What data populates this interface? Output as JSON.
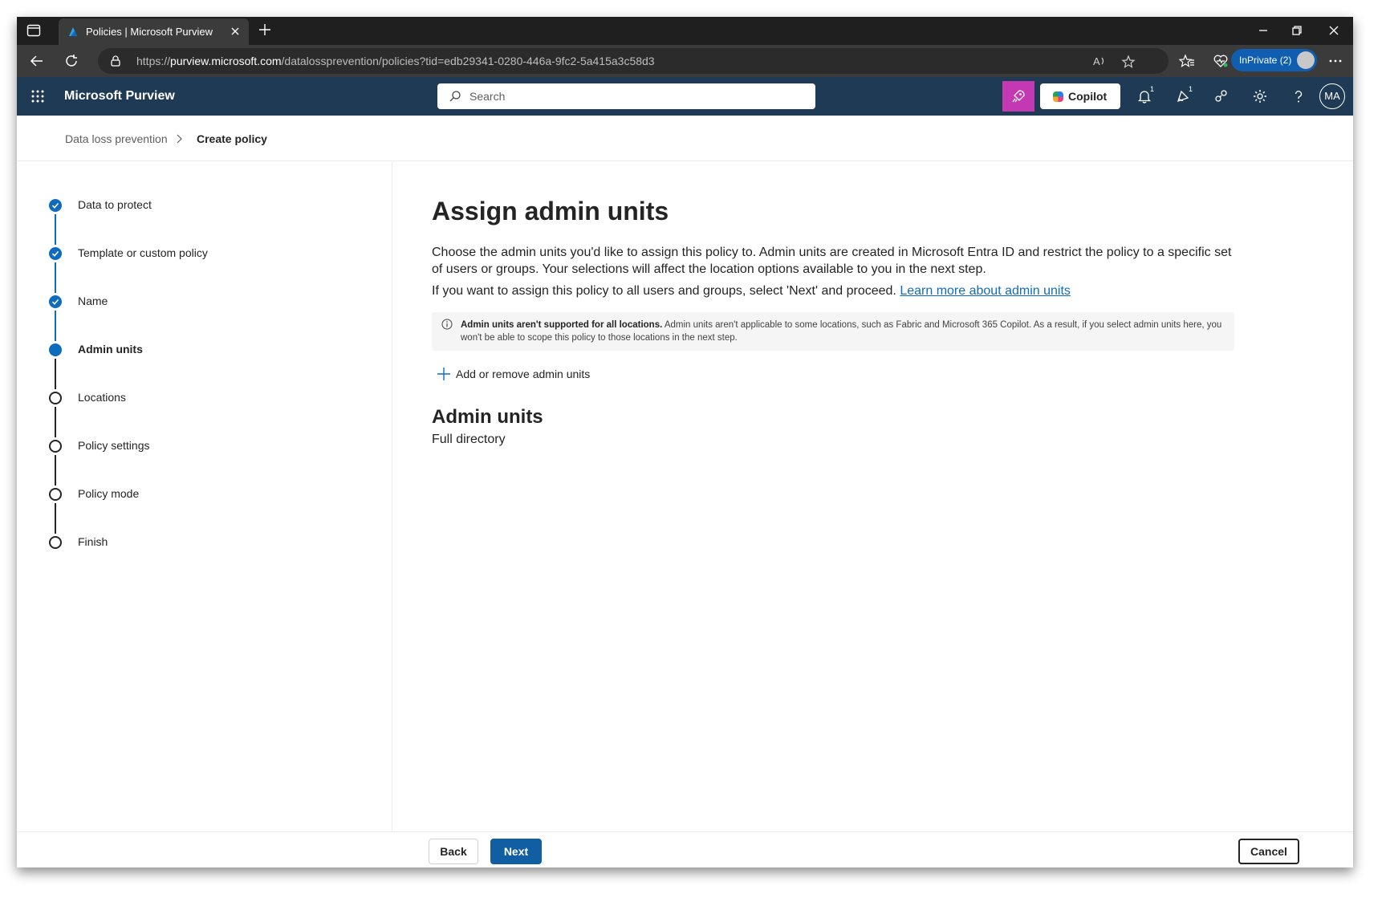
{
  "browser": {
    "tab_title": "Policies | Microsoft Purview",
    "url_prefix": "https://",
    "url_host": "purview.microsoft.com",
    "url_path": "/datalossprevention/policies?tid=edb29341-0280-446a-9fc2-5a415a3c58d3",
    "inprivate_label": "InPrivate (2)"
  },
  "app": {
    "brand": "Microsoft Purview",
    "search_placeholder": "Search",
    "copilot_label": "Copilot",
    "notifications_badge": "1",
    "whats_new_badge": "1",
    "avatar_initials": "MA"
  },
  "breadcrumb": {
    "parent": "Data loss prevention",
    "current": "Create policy"
  },
  "wizard": {
    "steps": [
      {
        "label": "Data to protect",
        "state": "done"
      },
      {
        "label": "Template or custom policy",
        "state": "done"
      },
      {
        "label": "Name",
        "state": "done"
      },
      {
        "label": "Admin units",
        "state": "current"
      },
      {
        "label": "Locations",
        "state": "todo"
      },
      {
        "label": "Policy settings",
        "state": "todo"
      },
      {
        "label": "Policy mode",
        "state": "todo"
      },
      {
        "label": "Finish",
        "state": "todo"
      }
    ]
  },
  "main": {
    "title": "Assign admin units",
    "description": "Choose the admin units you'd like to assign this policy to. Admin units are created in Microsoft Entra ID and restrict the policy to a specific set of users or groups. Your selections will affect the location options available to you in the next step.",
    "proceed_text": "If you want to assign this policy to all users and groups, select 'Next' and proceed.",
    "learn_more_link": "Learn more about admin units",
    "info_bold": "Admin units aren't supported for all locations.",
    "info_text": "Admin units aren't applicable to some locations, such as Fabric and Microsoft 365 Copilot. As a result, if you select admin units here, you won't be able to scope this policy to those locations in the next step.",
    "add_remove_label": "Add or remove admin units",
    "section_title": "Admin units",
    "section_value": "Full directory"
  },
  "footer": {
    "back_label": "Back",
    "next_label": "Next",
    "cancel_label": "Cancel"
  },
  "colors": {
    "appbar": "#1e3a55",
    "accent": "#0f6cbd",
    "primary_button": "#115ea3",
    "copilot_pink": "#c239b3"
  }
}
